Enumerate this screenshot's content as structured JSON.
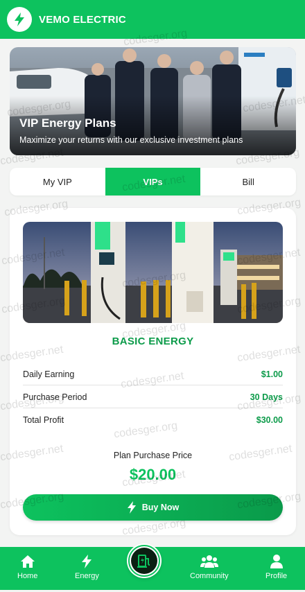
{
  "header": {
    "title": "VEMO ELECTRIC"
  },
  "hero": {
    "title": "VIP Energy Plans",
    "subtitle": "Maximize your returns with our exclusive investment plans"
  },
  "tabs": [
    {
      "label": "My VIP",
      "active": false
    },
    {
      "label": "VIPs",
      "active": true
    },
    {
      "label": "Bill",
      "active": false
    }
  ],
  "plan": {
    "name": "BASIC ENERGY",
    "rows": [
      {
        "label": "Daily Earning",
        "value": "$1.00"
      },
      {
        "label": "Purchase Period",
        "value": "30 Days"
      },
      {
        "label": "Total Profit",
        "value": "$30.00"
      }
    ],
    "price_label": "Plan Purchase Price",
    "price": "$20.00",
    "buy_label": "Buy Now"
  },
  "nav": {
    "home": "Home",
    "energy": "Energy",
    "community": "Community",
    "profile": "Profile"
  },
  "watermarks": [
    "codesger.org",
    "codesger.net"
  ],
  "colors": {
    "accent": "#0dc25e",
    "accent_dark": "#0c9b4a"
  },
  "icons": {
    "logo": "bolt-icon",
    "buy": "bolt-icon",
    "home": "home-icon",
    "energy": "bolt-icon",
    "center": "ev-charger-icon",
    "community": "users-icon",
    "profile": "user-icon"
  }
}
